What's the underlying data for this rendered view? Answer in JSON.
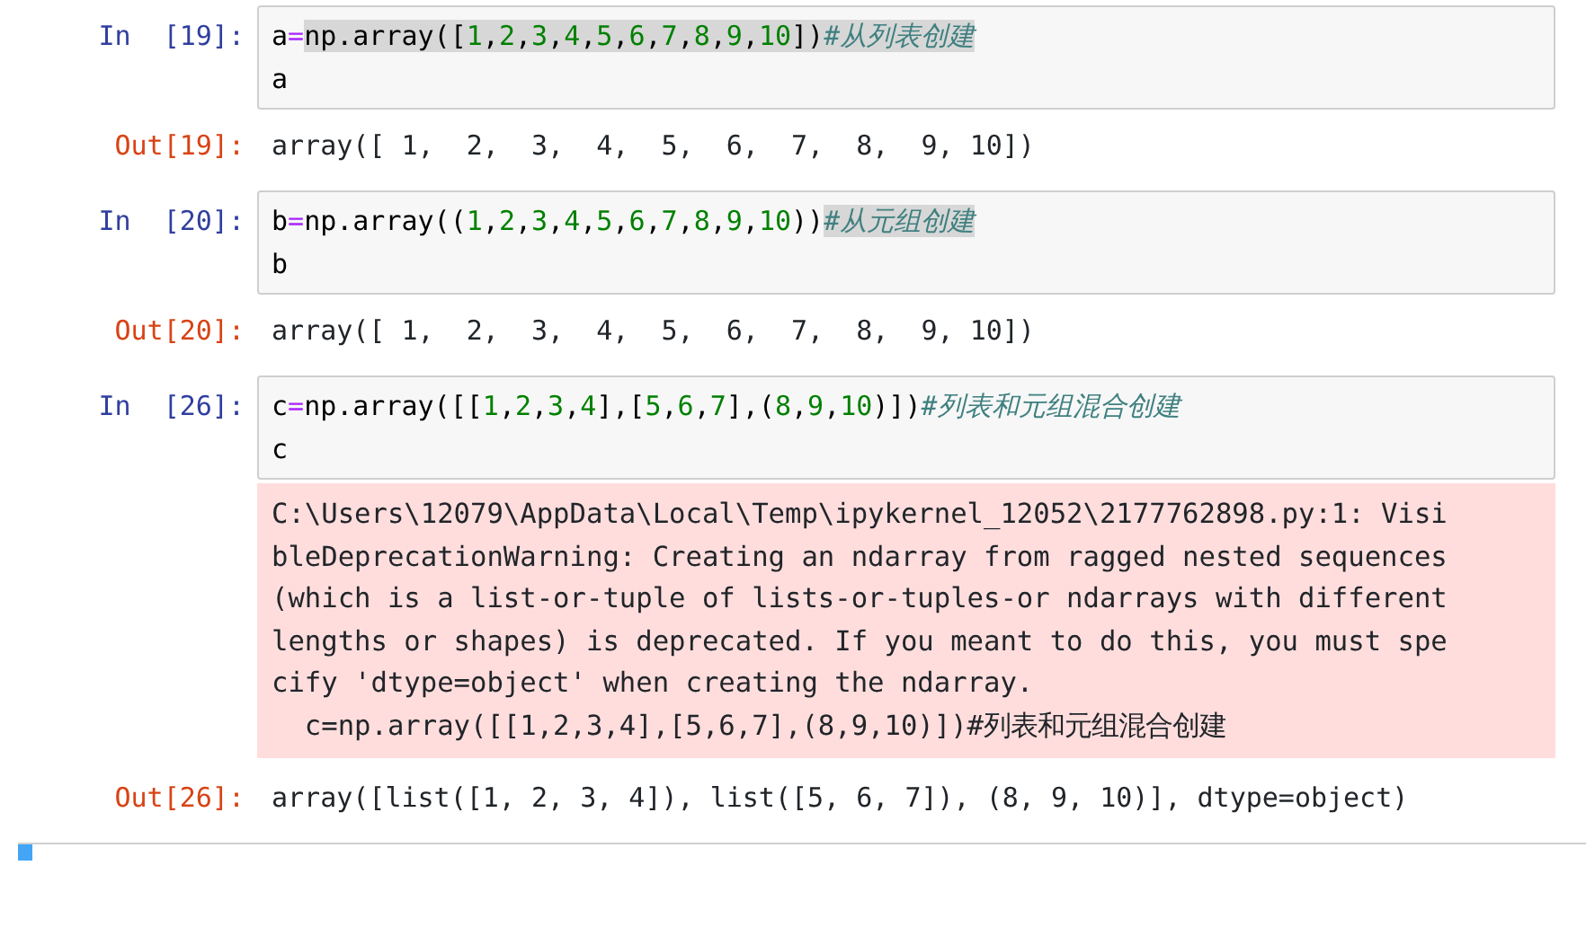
{
  "cells": [
    {
      "prompt": "In  [19]:",
      "code_lines": [
        [
          {
            "t": "a",
            "kind": "name",
            "highlighted": false
          },
          {
            "t": "=",
            "kind": "op",
            "highlighted": false
          },
          {
            "t": "np.array([",
            "kind": "name",
            "highlighted": true
          },
          {
            "t": "1",
            "kind": "num",
            "highlighted": true
          },
          {
            "t": ",",
            "kind": "punct",
            "highlighted": true
          },
          {
            "t": "2",
            "kind": "num",
            "highlighted": true
          },
          {
            "t": ",",
            "kind": "punct",
            "highlighted": true
          },
          {
            "t": "3",
            "kind": "num",
            "highlighted": true
          },
          {
            "t": ",",
            "kind": "punct",
            "highlighted": true
          },
          {
            "t": "4",
            "kind": "num",
            "highlighted": true
          },
          {
            "t": ",",
            "kind": "punct",
            "highlighted": true
          },
          {
            "t": "5",
            "kind": "num",
            "highlighted": true
          },
          {
            "t": ",",
            "kind": "punct",
            "highlighted": true
          },
          {
            "t": "6",
            "kind": "num",
            "highlighted": true
          },
          {
            "t": ",",
            "kind": "punct",
            "highlighted": true
          },
          {
            "t": "7",
            "kind": "num",
            "highlighted": true
          },
          {
            "t": ",",
            "kind": "punct",
            "highlighted": true
          },
          {
            "t": "8",
            "kind": "num",
            "highlighted": true
          },
          {
            "t": ",",
            "kind": "punct",
            "highlighted": true
          },
          {
            "t": "9",
            "kind": "num",
            "highlighted": true
          },
          {
            "t": ",",
            "kind": "punct",
            "highlighted": true
          },
          {
            "t": "10",
            "kind": "num",
            "highlighted": true
          },
          {
            "t": "])",
            "kind": "punct",
            "highlighted": true
          },
          {
            "t": "#从列表创建",
            "kind": "comment",
            "highlighted": true
          }
        ],
        [
          {
            "t": "a",
            "kind": "name",
            "highlighted": false
          }
        ]
      ],
      "outputs": [
        {
          "kind": "result",
          "prompt": "Out[19]:",
          "text": "array([ 1,  2,  3,  4,  5,  6,  7,  8,  9, 10])"
        }
      ]
    },
    {
      "prompt": "In  [20]:",
      "code_lines": [
        [
          {
            "t": "b",
            "kind": "name",
            "highlighted": false
          },
          {
            "t": "=",
            "kind": "op",
            "highlighted": false
          },
          {
            "t": "np.array((",
            "kind": "name",
            "highlighted": false
          },
          {
            "t": "1",
            "kind": "num",
            "highlighted": false
          },
          {
            "t": ",",
            "kind": "punct",
            "highlighted": false
          },
          {
            "t": "2",
            "kind": "num",
            "highlighted": false
          },
          {
            "t": ",",
            "kind": "punct",
            "highlighted": false
          },
          {
            "t": "3",
            "kind": "num",
            "highlighted": false
          },
          {
            "t": ",",
            "kind": "punct",
            "highlighted": false
          },
          {
            "t": "4",
            "kind": "num",
            "highlighted": false
          },
          {
            "t": ",",
            "kind": "punct",
            "highlighted": false
          },
          {
            "t": "5",
            "kind": "num",
            "highlighted": false
          },
          {
            "t": ",",
            "kind": "punct",
            "highlighted": false
          },
          {
            "t": "6",
            "kind": "num",
            "highlighted": false
          },
          {
            "t": ",",
            "kind": "punct",
            "highlighted": false
          },
          {
            "t": "7",
            "kind": "num",
            "highlighted": false
          },
          {
            "t": ",",
            "kind": "punct",
            "highlighted": false
          },
          {
            "t": "8",
            "kind": "num",
            "highlighted": false
          },
          {
            "t": ",",
            "kind": "punct",
            "highlighted": false
          },
          {
            "t": "9",
            "kind": "num",
            "highlighted": false
          },
          {
            "t": ",",
            "kind": "punct",
            "highlighted": false
          },
          {
            "t": "10",
            "kind": "num",
            "highlighted": false
          },
          {
            "t": "))",
            "kind": "punct",
            "highlighted": false
          },
          {
            "t": "#从元组创建",
            "kind": "comment",
            "highlighted": true
          }
        ],
        [
          {
            "t": "b",
            "kind": "name",
            "highlighted": false
          }
        ]
      ],
      "outputs": [
        {
          "kind": "result",
          "prompt": "Out[20]:",
          "text": "array([ 1,  2,  3,  4,  5,  6,  7,  8,  9, 10])"
        }
      ]
    },
    {
      "prompt": "In  [26]:",
      "code_lines": [
        [
          {
            "t": "c",
            "kind": "name",
            "highlighted": false
          },
          {
            "t": "=",
            "kind": "op",
            "highlighted": false
          },
          {
            "t": "np.array([[",
            "kind": "name",
            "highlighted": false
          },
          {
            "t": "1",
            "kind": "num",
            "highlighted": false
          },
          {
            "t": ",",
            "kind": "punct",
            "highlighted": false
          },
          {
            "t": "2",
            "kind": "num",
            "highlighted": false
          },
          {
            "t": ",",
            "kind": "punct",
            "highlighted": false
          },
          {
            "t": "3",
            "kind": "num",
            "highlighted": false
          },
          {
            "t": ",",
            "kind": "punct",
            "highlighted": false
          },
          {
            "t": "4",
            "kind": "num",
            "highlighted": false
          },
          {
            "t": "],[",
            "kind": "punct",
            "highlighted": false
          },
          {
            "t": "5",
            "kind": "num",
            "highlighted": false
          },
          {
            "t": ",",
            "kind": "punct",
            "highlighted": false
          },
          {
            "t": "6",
            "kind": "num",
            "highlighted": false
          },
          {
            "t": ",",
            "kind": "punct",
            "highlighted": false
          },
          {
            "t": "7",
            "kind": "num",
            "highlighted": false
          },
          {
            "t": "],(",
            "kind": "punct",
            "highlighted": false
          },
          {
            "t": "8",
            "kind": "num",
            "highlighted": false
          },
          {
            "t": ",",
            "kind": "punct",
            "highlighted": false
          },
          {
            "t": "9",
            "kind": "num",
            "highlighted": false
          },
          {
            "t": ",",
            "kind": "punct",
            "highlighted": false
          },
          {
            "t": "10",
            "kind": "num",
            "highlighted": false
          },
          {
            "t": ")])",
            "kind": "punct",
            "highlighted": false
          },
          {
            "t": "#列表和元组混合创建",
            "kind": "comment",
            "highlighted": false
          }
        ],
        [
          {
            "t": "c",
            "kind": "name",
            "highlighted": false
          }
        ]
      ],
      "outputs": [
        {
          "kind": "stderr",
          "lines": [
            "C:\\Users\\12079\\AppData\\Local\\Temp\\ipykernel_12052\\2177762898.py:1: Visi",
            "bleDeprecationWarning: Creating an ndarray from ragged nested sequences",
            "(which is a list-or-tuple of lists-or-tuples-or ndarrays with different",
            "lengths or shapes) is deprecated. If you meant to do this, you must spe",
            "cify 'dtype=object' when creating the ndarray.",
            "  c=np.array([[1,2,3,4],[5,6,7],(8,9,10)])#列表和元组混合创建"
          ]
        },
        {
          "kind": "result",
          "prompt": "Out[26]:",
          "text": "array([list([1, 2, 3, 4]), list([5, 6, 7]), (8, 9, 10)], dtype=object)"
        }
      ]
    }
  ]
}
